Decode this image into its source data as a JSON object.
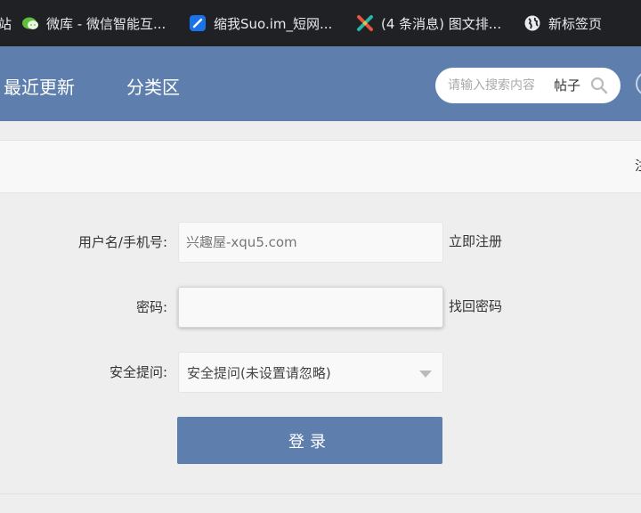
{
  "bookmarks": [
    {
      "icon": "globe-icon",
      "label": "站"
    },
    {
      "icon": "wechat-icon",
      "label": "微库 - 微信智能互..."
    },
    {
      "icon": "suoim-icon",
      "label": "缩我Suo.im_短网..."
    },
    {
      "icon": "csdn-icon",
      "label": "(4 条消息) 图文排..."
    },
    {
      "icon": "globe-icon",
      "label": "新标签页"
    }
  ],
  "header": {
    "nav": [
      "最近更新",
      "分类区"
    ],
    "search": {
      "placeholder": "请输入搜索内容",
      "type_label": "帖子",
      "icon": "search-icon"
    }
  },
  "subbar": {
    "edge_text": "注"
  },
  "form": {
    "username": {
      "label": "用户名/手机号:",
      "placeholder": "兴趣屋-xqu5.com",
      "value": "",
      "link": "立即注册"
    },
    "password": {
      "label": "密码:",
      "value": "",
      "link": "找回密码"
    },
    "security": {
      "label": "安全提问:",
      "selected": "安全提问(未设置请忽略)"
    },
    "submit_label": "登录"
  },
  "colors": {
    "brand": "#5e7fad",
    "bookmark_bar": "#202124",
    "page_bg": "#efeeef"
  }
}
